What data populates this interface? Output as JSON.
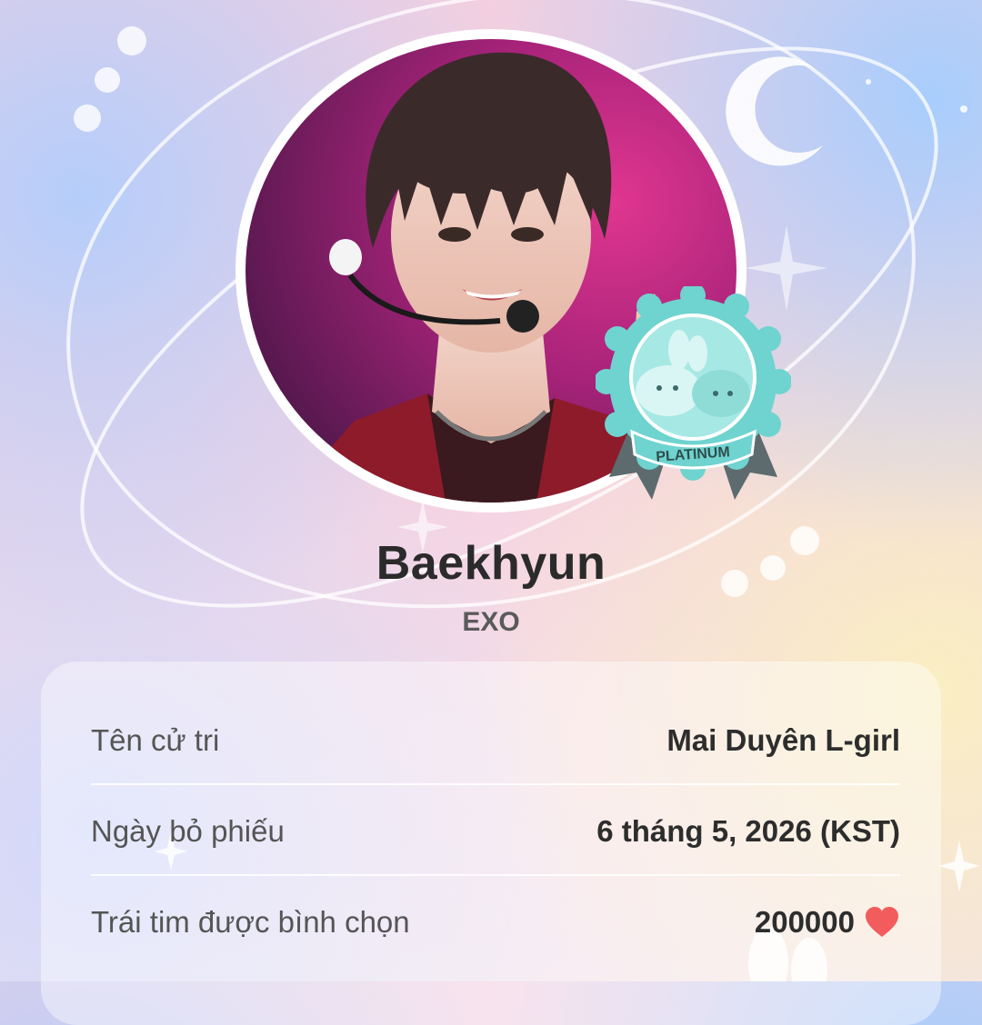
{
  "idol": {
    "name": "Baekhyun",
    "group": "EXO",
    "tier_badge": "PLATINUM"
  },
  "vote_details": [
    {
      "label": "Tên cử tri",
      "value": "Mai Duyên L-girl"
    },
    {
      "label": "Ngày bỏ phiếu",
      "value": "6 tháng 5, 2026 (KST)"
    },
    {
      "label": "Trái tim được bình chọn",
      "value": "200000",
      "icon": "heart-icon"
    }
  ],
  "colors": {
    "badge_teal": "#6fd3cf",
    "badge_ribbon": "#5d6b6f",
    "heart": "#f25c5c",
    "avatar_bg": "#a81e70"
  }
}
